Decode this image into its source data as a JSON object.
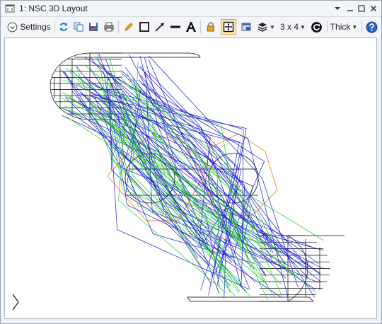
{
  "window": {
    "title": "1: NSC 3D Layout",
    "controls": [
      "dropdown-arrow-icon",
      "minimize-icon",
      "maximize-icon",
      "close-icon"
    ]
  },
  "toolbar": {
    "settings_label": "Settings",
    "layout_label": "3 x 4",
    "thickness_label": "Thick",
    "buttons": [
      "settings-toggle",
      "refresh-icon",
      "copy-icon",
      "save-icon",
      "print-icon",
      "pencil-icon",
      "rectangle-icon",
      "arrow-line-icon",
      "line-icon",
      "text-icon",
      "lock-icon",
      "fit-view-icon",
      "window-icon",
      "layers-icon",
      "layout-grid",
      "rotate-icon",
      "thickness-select",
      "help-icon"
    ]
  },
  "colors": {
    "ray_blue": "#1a1ad6",
    "ray_green": "#1ed11e",
    "geometry": "#000000",
    "prism": "#f08a24",
    "accent": "#e2a43a"
  }
}
